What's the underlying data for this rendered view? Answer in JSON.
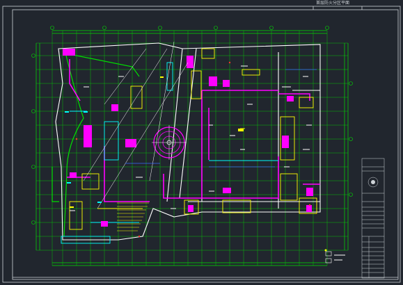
{
  "drawing": {
    "title": "首层防火分区平面",
    "background": "#21262e",
    "colors": {
      "frame": "#cfd4d9",
      "grid": "#00e000",
      "wall": "#ffffff",
      "magenta": "#ff00ff",
      "yellow": "#ffff00",
      "cyan": "#00ffff",
      "blue": "#3a6bff",
      "red": "#ff3030"
    }
  }
}
